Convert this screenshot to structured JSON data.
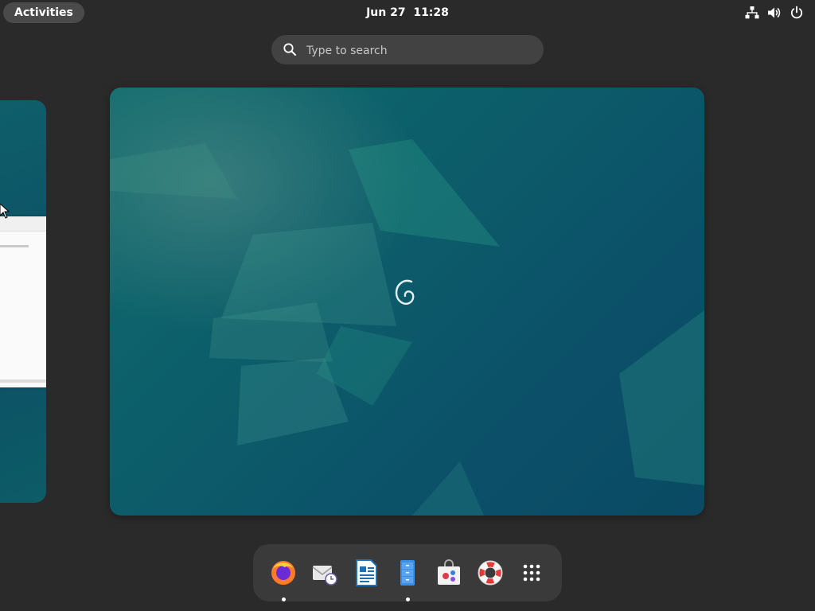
{
  "topbar": {
    "activities_label": "Activities",
    "date": "Jun 27",
    "time": "11:28",
    "tray_icons": [
      "network-icon",
      "volume-icon",
      "power-icon"
    ]
  },
  "search": {
    "placeholder": "Type to search",
    "value": ""
  },
  "workspaces": [
    {
      "name": "workspace-1",
      "has_window": true
    },
    {
      "name": "workspace-2",
      "active": true,
      "has_window": false
    }
  ],
  "dash": {
    "items": [
      {
        "name": "Firefox",
        "icon": "firefox-icon",
        "running": true
      },
      {
        "name": "Evolution",
        "icon": "mail-clock-icon",
        "running": false
      },
      {
        "name": "LibreOffice Writer",
        "icon": "writer-document-icon",
        "running": false
      },
      {
        "name": "Files",
        "icon": "file-cabinet-icon",
        "running": true
      },
      {
        "name": "Software",
        "icon": "software-bag-icon",
        "running": false
      },
      {
        "name": "Help",
        "icon": "lifebuoy-icon",
        "running": false
      },
      {
        "name": "Show Applications",
        "icon": "app-grid-icon",
        "running": false
      }
    ]
  },
  "colors": {
    "panel_bg": "#2a2a2a",
    "pill_bg": "#424242",
    "dash_bg": "#3a3a3a",
    "wallpaper": "#0c5d6a"
  }
}
